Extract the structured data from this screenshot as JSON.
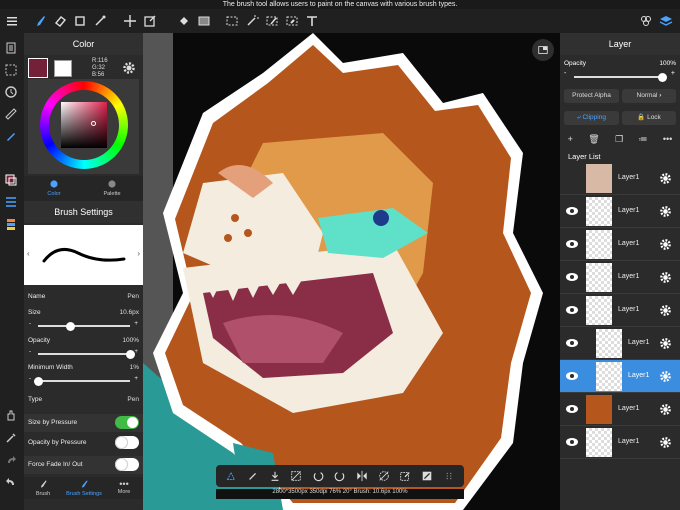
{
  "tooltip": "The brush tool allows users to paint on the canvas with various brush types.",
  "toolbar": {
    "tools": [
      "menu-icon",
      "brush-icon",
      "eraser-icon",
      "rectangle-icon",
      "magic-wand-icon",
      "move-icon",
      "transform-icon",
      "fill-icon",
      "gradient-icon",
      "select-rect-icon",
      "magic-select-icon",
      "select-pen-icon",
      "select-eraser-icon",
      "text-icon",
      "layers-group-icon",
      "layers-icon"
    ]
  },
  "color_panel": {
    "title": "Color",
    "rgb": {
      "r": "R:116",
      "g": "G:32",
      "b": "B:56"
    },
    "current_color": "#742038",
    "tabs": {
      "color": "Color",
      "palette": "Palette"
    }
  },
  "brush_settings": {
    "title": "Brush Settings",
    "name_label": "Name",
    "name_value": "Pen",
    "size_label": "Size",
    "size_value": "10.6px",
    "size_level": 0.35,
    "opacity_label": "Opacity",
    "opacity_value": "100%",
    "opacity_level": 1.0,
    "min_width_label": "Minimum Width",
    "min_width_value": "1%",
    "min_width_level": 0.01,
    "type_label": "Type",
    "type_value": "Pen",
    "size_by_pressure": "Size by Pressure",
    "opacity_by_pressure": "Opacity by Pressure",
    "force_fade": "Force Fade In/ Out",
    "tabs": {
      "brush": "Brush",
      "brush_settings": "Brush Settings",
      "more": "More"
    }
  },
  "layer_panel": {
    "title": "Layer",
    "opacity_label": "Opacity",
    "opacity_value": "100%",
    "opacity_level": 1.0,
    "protect_alpha": "Protect Alpha",
    "blend_mode": "Normal",
    "clipping": "Clipping",
    "lock": "Lock",
    "list_title": "Layer List",
    "layers": [
      "Layer1",
      "Layer1",
      "Layer1",
      "Layer1",
      "Layer1",
      "Layer1",
      "Layer1",
      "Layer1",
      "Layer1"
    ]
  },
  "status": "2800*3500px 350dpi 76% 20° Brush: 10.6px 100%"
}
